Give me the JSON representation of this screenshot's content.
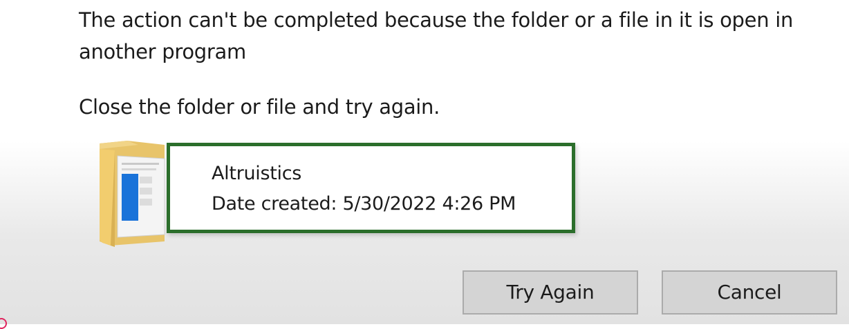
{
  "dialog": {
    "message": "The action can't be completed because the folder or a file in it is open in another program",
    "hint": "Close the folder or file and try again.",
    "file": {
      "name": "Altruistics",
      "date_created": "Date created: 5/30/2022 4:26 PM",
      "icon": "folder-icon"
    },
    "buttons": {
      "try_again_label": "Try Again",
      "cancel_label": "Cancel"
    }
  },
  "colors": {
    "highlight_border": "#2b6e2b",
    "button_background": "#d4d4d4",
    "button_border": "#ababab"
  }
}
